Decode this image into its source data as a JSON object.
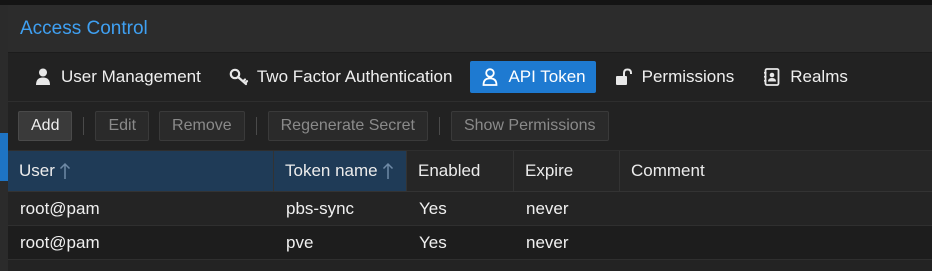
{
  "panel": {
    "title": "Access Control"
  },
  "tabs": [
    {
      "label": "User Management",
      "icon": "user-icon"
    },
    {
      "label": "Two Factor Authentication",
      "icon": "key-icon"
    },
    {
      "label": "API Token",
      "icon": "user-outline-icon",
      "active": true
    },
    {
      "label": "Permissions",
      "icon": "unlock-icon"
    },
    {
      "label": "Realms",
      "icon": "address-book-icon"
    }
  ],
  "toolbar": {
    "add": "Add",
    "edit": "Edit",
    "remove": "Remove",
    "regenerate": "Regenerate Secret",
    "show_permissions": "Show Permissions"
  },
  "table": {
    "columns": [
      "User",
      "Token name",
      "Enabled",
      "Expire",
      "Comment"
    ],
    "rows": [
      [
        "root@pam",
        "pbs-sync",
        "Yes",
        "never",
        ""
      ],
      [
        "root@pam",
        "pve",
        "Yes",
        "never",
        ""
      ]
    ]
  },
  "colors": {
    "accent": "#1e7ad1",
    "title": "#3fa0f2",
    "sorted_header": "#1f3b57"
  }
}
